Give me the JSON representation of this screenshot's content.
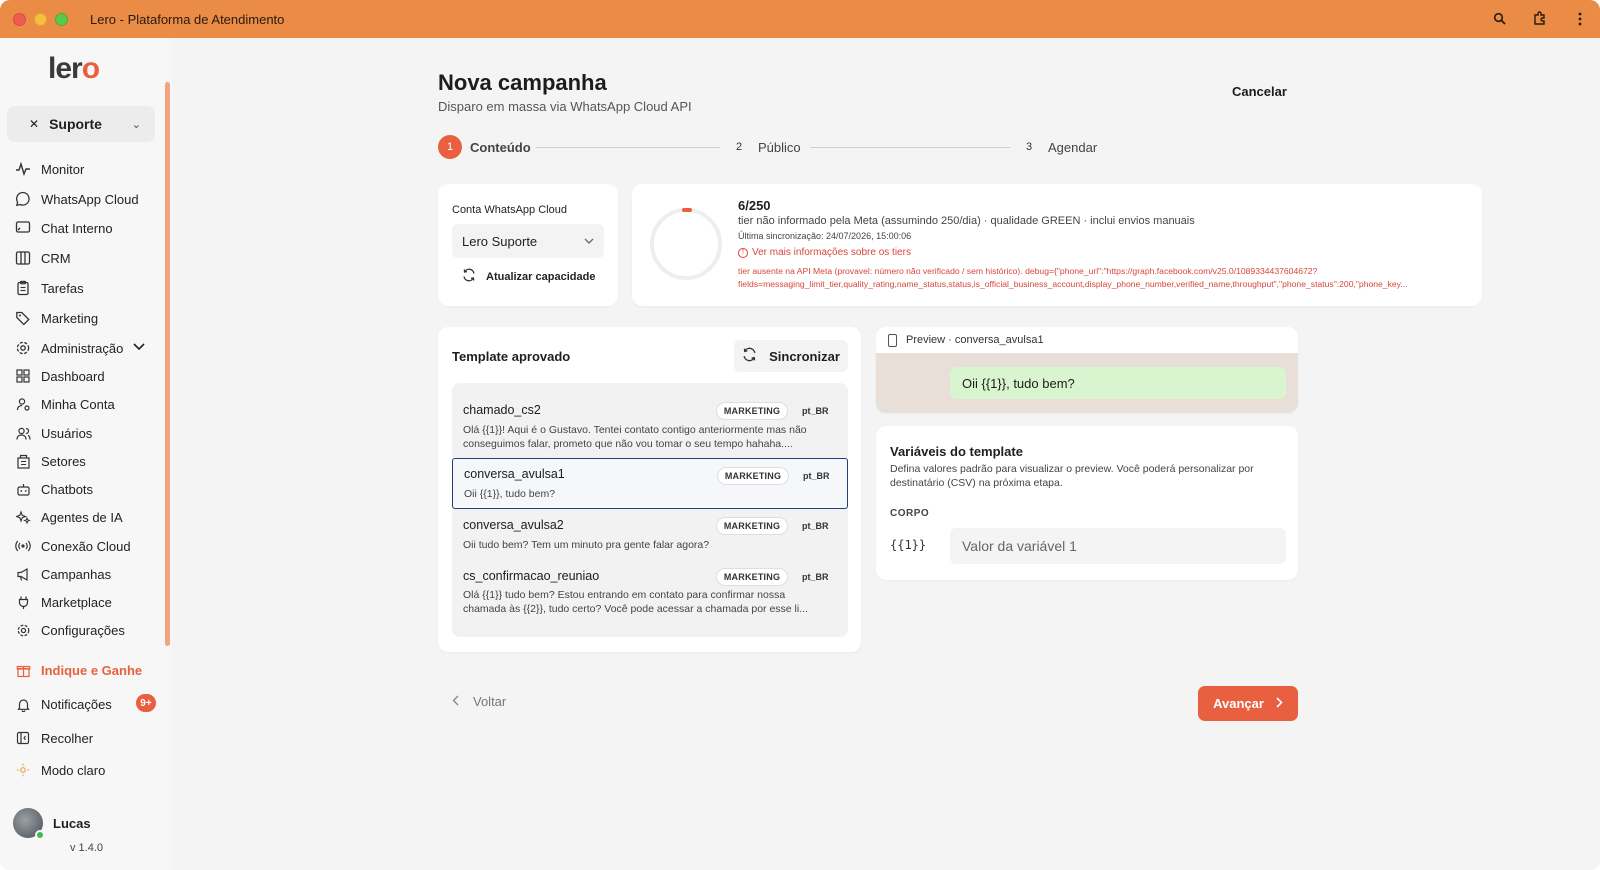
{
  "window": {
    "title": "Lero - Plataforma de Atendimento"
  },
  "sidebar": {
    "logo": "lero",
    "team": "Suporte",
    "items": [
      {
        "label": "Monitor",
        "icon": "activity-icon"
      },
      {
        "label": "WhatsApp Cloud",
        "icon": "whatsapp-icon"
      },
      {
        "label": "Chat Interno",
        "icon": "chat-icon"
      },
      {
        "label": "CRM",
        "icon": "columns-icon"
      },
      {
        "label": "Tarefas",
        "icon": "clipboard-icon"
      },
      {
        "label": "Marketing",
        "icon": "tag-icon"
      },
      {
        "label": "Administração",
        "icon": "gear-icon"
      },
      {
        "label": "Dashboard",
        "icon": "grid-icon"
      },
      {
        "label": "Minha Conta",
        "icon": "user-gear-icon"
      },
      {
        "label": "Usuários",
        "icon": "users-icon"
      },
      {
        "label": "Setores",
        "icon": "building-icon"
      },
      {
        "label": "Chatbots",
        "icon": "bot-icon"
      },
      {
        "label": "Agentes de IA",
        "icon": "sparkles-icon"
      },
      {
        "label": "Conexão Cloud",
        "icon": "radio-icon"
      },
      {
        "label": "Campanhas",
        "icon": "megaphone-icon"
      },
      {
        "label": "Marketplace",
        "icon": "plug-icon"
      },
      {
        "label": "Configurações",
        "icon": "settings-icon"
      }
    ],
    "referral": "Indique e Ganhe",
    "notifications": "Notificações",
    "notifications_badge": "9+",
    "collapse": "Recolher",
    "theme": "Modo claro",
    "user_name": "Lucas",
    "version": "v 1.4.0"
  },
  "page": {
    "title": "Nova campanha",
    "subtitle": "Disparo em massa via WhatsApp Cloud API",
    "cancel": "Cancelar"
  },
  "stepper": {
    "steps": [
      {
        "num": "1",
        "label": "Conteúdo"
      },
      {
        "num": "2",
        "label": "Público"
      },
      {
        "num": "3",
        "label": "Agendar"
      }
    ],
    "active": 1
  },
  "account": {
    "label": "Conta WhatsApp Cloud",
    "selected": "Lero Suporte",
    "refresh": "Atualizar capacidade"
  },
  "capacity": {
    "value": "6/250",
    "used": 6,
    "limit": 250,
    "description": "tier não informado pela Meta (assumindo 250/dia) · qualidade GREEN · inclui envios manuais",
    "last_sync": "Última sincronização: 24/07/2026, 15:00:06",
    "more_info": "Ver mais informações sobre os tiers",
    "debug_line1": "tier ausente na API Meta (provavel: número não verificado / sem histórico). debug={\"phone_url\":\"https://graph.facebook.com/v25.0/1089334437604672?",
    "debug_line2": "fields=messaging_limit_tier,quality_rating,name_status,status,is_official_business_account,display_phone_number,verified_name,throughput\",\"phone_status\":200,\"phone_key..."
  },
  "templates": {
    "title": "Template aprovado",
    "sync": "Sincronizar",
    "items": [
      {
        "name": "chamado_cs2",
        "category": "MARKETING",
        "lang": "pt_BR",
        "body1": "Olá {{1}}! Aqui é o Gustavo. Tentei contato contigo anteriormente mas não",
        "body2": "conseguimos falar, prometo que não vou tomar o seu tempo hahaha...."
      },
      {
        "name": "conversa_avulsa1",
        "category": "MARKETING",
        "lang": "pt_BR",
        "body1": "Oii {{1}}, tudo bem?",
        "body2": ""
      },
      {
        "name": "conversa_avulsa2",
        "category": "MARKETING",
        "lang": "pt_BR",
        "body1": "Oii tudo bem? Tem um minuto pra gente falar agora?",
        "body2": ""
      },
      {
        "name": "cs_confirmacao_reuniao",
        "category": "MARKETING",
        "lang": "pt_BR",
        "body1": "Olá {{1}} tudo bem? Estou entrando em contato para confirmar nossa",
        "body2": "chamada às {{2}}, tudo certo? Você pode acessar a chamada por esse li..."
      }
    ]
  },
  "preview": {
    "header": "Preview · conversa_avulsa1",
    "message": "Oii {{1}}, tudo bem?"
  },
  "variables": {
    "title": "Variáveis do template",
    "description": "Defina valores padrão para visualizar o preview. Você poderá personalizar por destinatário (CSV) na próxima etapa.",
    "section": "CORPO",
    "key": "{{1}}",
    "placeholder": "Valor da variável 1"
  },
  "footer": {
    "back": "Voltar",
    "next": "Avançar"
  },
  "colors": {
    "accent": "#e8603f",
    "titlebar": "#ea8c45",
    "selected_border": "#20407a"
  }
}
